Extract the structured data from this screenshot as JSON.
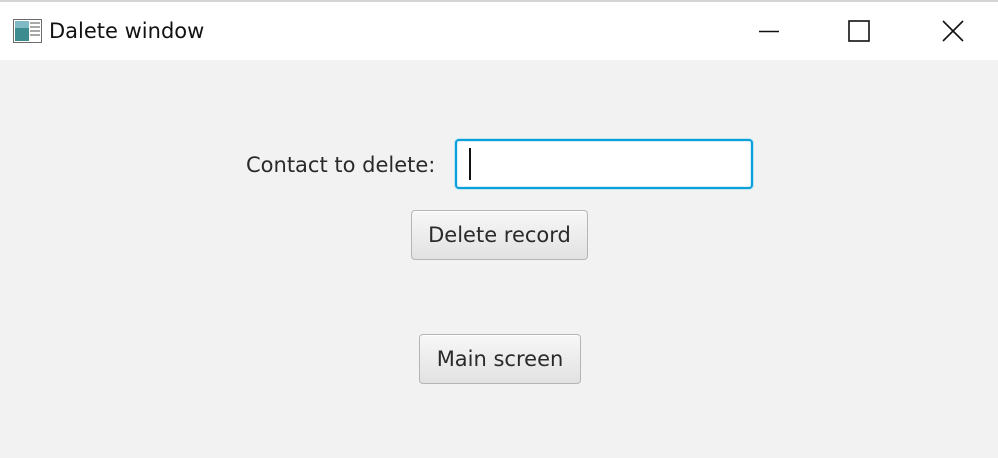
{
  "window": {
    "title": "Dalete window"
  },
  "icons": {
    "app": "java-app-icon",
    "minimize": "minimize-icon",
    "maximize": "maximize-icon",
    "close": "close-icon"
  },
  "form": {
    "contact_label": "Contact to delete:",
    "contact_value": "",
    "delete_button": "Delete record",
    "main_button": "Main screen"
  },
  "colors": {
    "focus_border": "#0aa0d9",
    "background": "#f2f2f2"
  }
}
